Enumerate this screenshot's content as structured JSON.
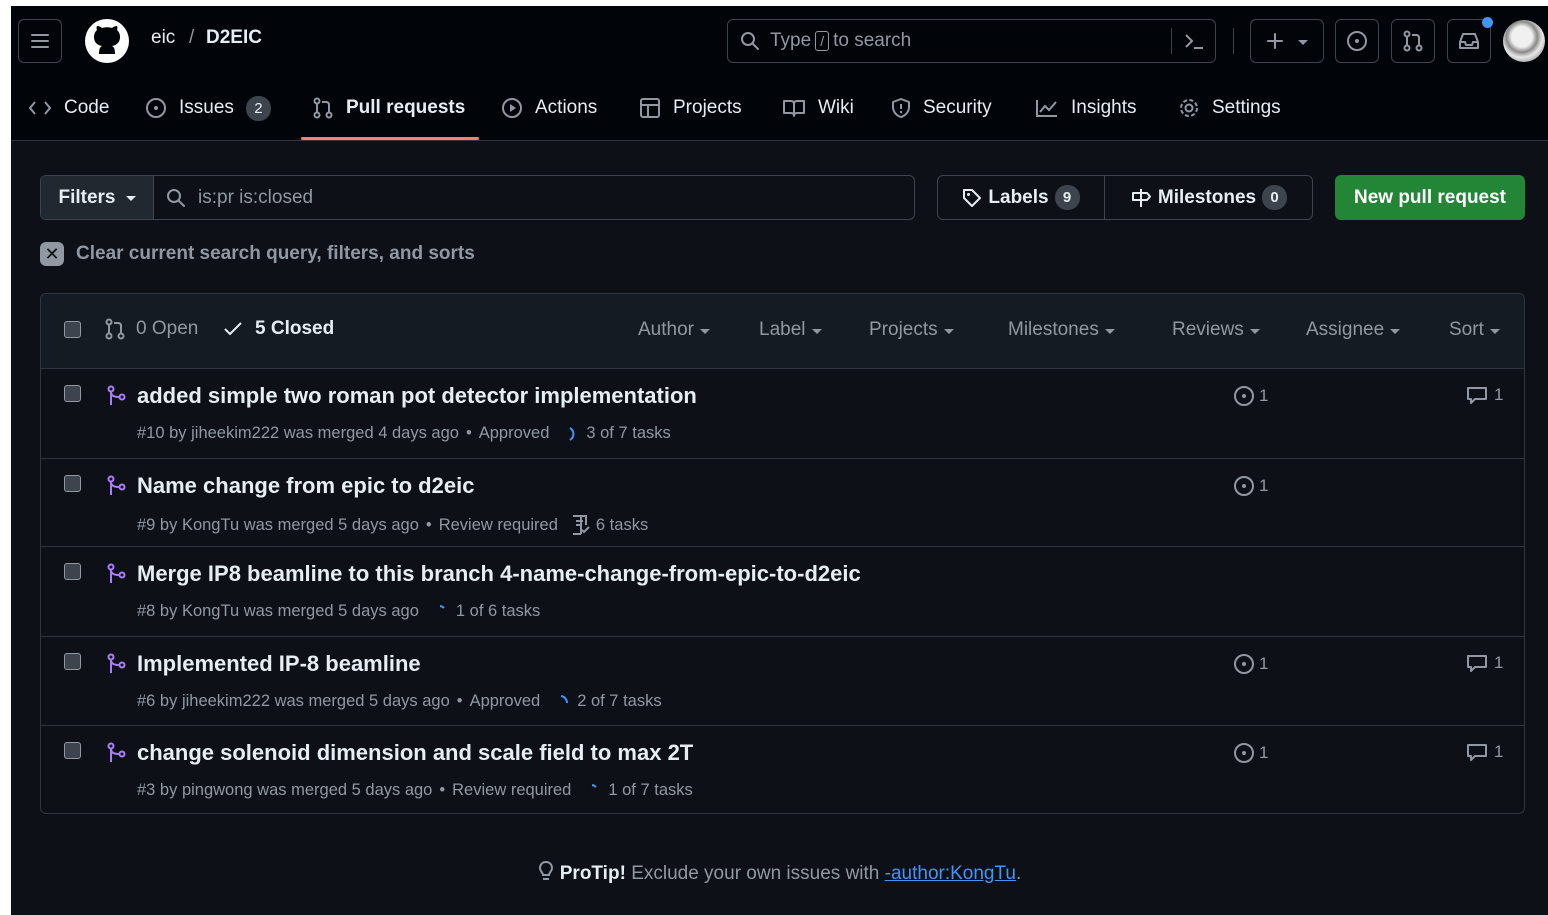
{
  "header": {
    "owner": "eic",
    "separator": "/",
    "repo": "D2EIC",
    "search_prefix": "Type",
    "search_key": "/",
    "search_suffix": "to search"
  },
  "nav": {
    "code": "Code",
    "issues": "Issues",
    "issues_count": "2",
    "pull_requests": "Pull requests",
    "actions": "Actions",
    "projects": "Projects",
    "wiki": "Wiki",
    "security": "Security",
    "insights": "Insights",
    "settings": "Settings"
  },
  "toolbar": {
    "filters": "Filters",
    "query": "is:pr is:closed",
    "labels": "Labels",
    "labels_count": "9",
    "milestones": "Milestones",
    "milestones_count": "0",
    "new_pr": "New pull request",
    "clear": "Clear current search query, filters, and sorts"
  },
  "list_header": {
    "open": "0 Open",
    "closed": "5 Closed",
    "filters": [
      "Author",
      "Label",
      "Projects",
      "Milestones",
      "Reviews",
      "Assignee",
      "Sort"
    ]
  },
  "pulls": [
    {
      "title": "added simple two roman pot detector implementation",
      "meta": "#10 by jiheekim222 was merged 4 days ago",
      "review": "Approved",
      "tasks": "3 of 7 tasks",
      "issues": "1",
      "comments": "1"
    },
    {
      "title": "Name change from epic to d2eic",
      "meta": "#9 by KongTu was merged 5 days ago",
      "review": "Review required",
      "tasks": "6 tasks",
      "issues": "1",
      "comments": ""
    },
    {
      "title": "Merge IP8 beamline to this branch 4-name-change-from-epic-to-d2eic",
      "meta": "#8 by KongTu was merged 5 days ago",
      "review": "",
      "tasks": "1 of 6 tasks",
      "issues": "",
      "comments": ""
    },
    {
      "title": "Implemented IP-8 beamline",
      "meta": "#6 by jiheekim222 was merged 5 days ago",
      "review": "Approved",
      "tasks": "2 of 7 tasks",
      "issues": "1",
      "comments": "1"
    },
    {
      "title": "change solenoid dimension and scale field to max 2T",
      "meta": "#3 by pingwong was merged 5 days ago",
      "review": "Review required",
      "tasks": "1 of 7 tasks",
      "issues": "1",
      "comments": "1"
    }
  ],
  "protip": {
    "label": "ProTip!",
    "text": "Exclude your own issues with",
    "link": "-author:KongTu",
    "end": "."
  },
  "colors": {
    "background": "#0d1117",
    "header": "#010409",
    "accent_underline": "#f78166",
    "merged": "#ab7df8",
    "new_pr_button": "#238636",
    "link": "#4493f8"
  }
}
